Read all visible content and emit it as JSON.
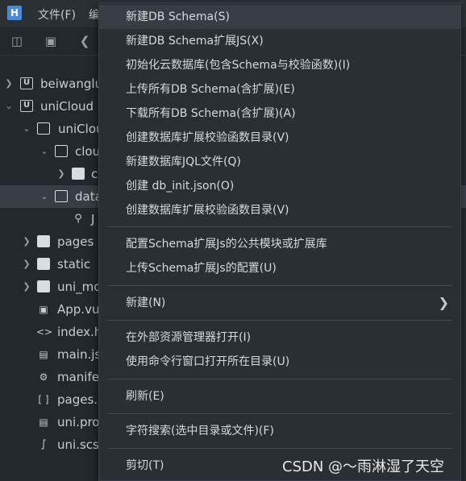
{
  "menubar": {
    "logo": "H",
    "file": "文件(F)",
    "edit": "编"
  },
  "toolbar": {
    "icons": [
      "new-file-icon",
      "save-icon",
      "back-icon"
    ]
  },
  "tree": [
    {
      "label": "beiwanglu",
      "icon": "u-project-icon",
      "arrow": "right"
    },
    {
      "label": "uniCloud",
      "icon": "u-project-icon",
      "arrow": "down"
    },
    {
      "label": "uniClou",
      "icon": "folder-icon",
      "arrow": "down"
    },
    {
      "label": "clou",
      "icon": "folder-icon",
      "arrow": "down"
    },
    {
      "label": "c",
      "icon": "folder-filled-icon",
      "arrow": "right"
    },
    {
      "label": "data",
      "icon": "folder-icon",
      "arrow": "down"
    },
    {
      "label": "J",
      "icon": "schema-file-icon",
      "arrow": ""
    },
    {
      "label": "pages",
      "icon": "folder-filled-icon",
      "arrow": "right"
    },
    {
      "label": "static",
      "icon": "folder-filled-icon",
      "arrow": "right"
    },
    {
      "label": "uni_mo",
      "icon": "folder-filled-icon",
      "arrow": "right"
    },
    {
      "label": "App.vu",
      "icon": "vue-file-icon",
      "arrow": ""
    },
    {
      "label": "index.h",
      "icon": "html-file-icon",
      "arrow": ""
    },
    {
      "label": "main.js",
      "icon": "js-file-icon",
      "arrow": ""
    },
    {
      "label": "manife",
      "icon": "manifest-file-icon",
      "arrow": ""
    },
    {
      "label": "pages.",
      "icon": "json-file-icon",
      "arrow": ""
    },
    {
      "label": "uni.pro",
      "icon": "js-file-icon",
      "arrow": ""
    },
    {
      "label": "uni.scs",
      "icon": "scss-file-icon",
      "arrow": ""
    }
  ],
  "context_menu": {
    "items": [
      "新建DB Schema(S)",
      "新建DB Schema扩展JS(X)",
      "初始化云数据库(包含Schema与校验函数)(I)",
      "上传所有DB Schema(含扩展)(E)",
      "下载所有DB Schema(含扩展)(A)",
      "创建数据库扩展校验函数目录(V)",
      "新建数据库JQL文件(Q)",
      "创建 db_init.json(O)",
      "创建数据库扩展校验函数目录(V)",
      "配置Schema扩展Js的公共模块或扩展库",
      "上传Schema扩展Js的配置(U)",
      "新建(N)",
      "在外部资源管理器打开(I)",
      "使用命令行窗口打开所在目录(U)",
      "刷新(E)",
      "字符搜索(选中目录或文件)(F)",
      "剪切(T)"
    ]
  },
  "watermark": "CSDN @～雨淋湿了天空"
}
